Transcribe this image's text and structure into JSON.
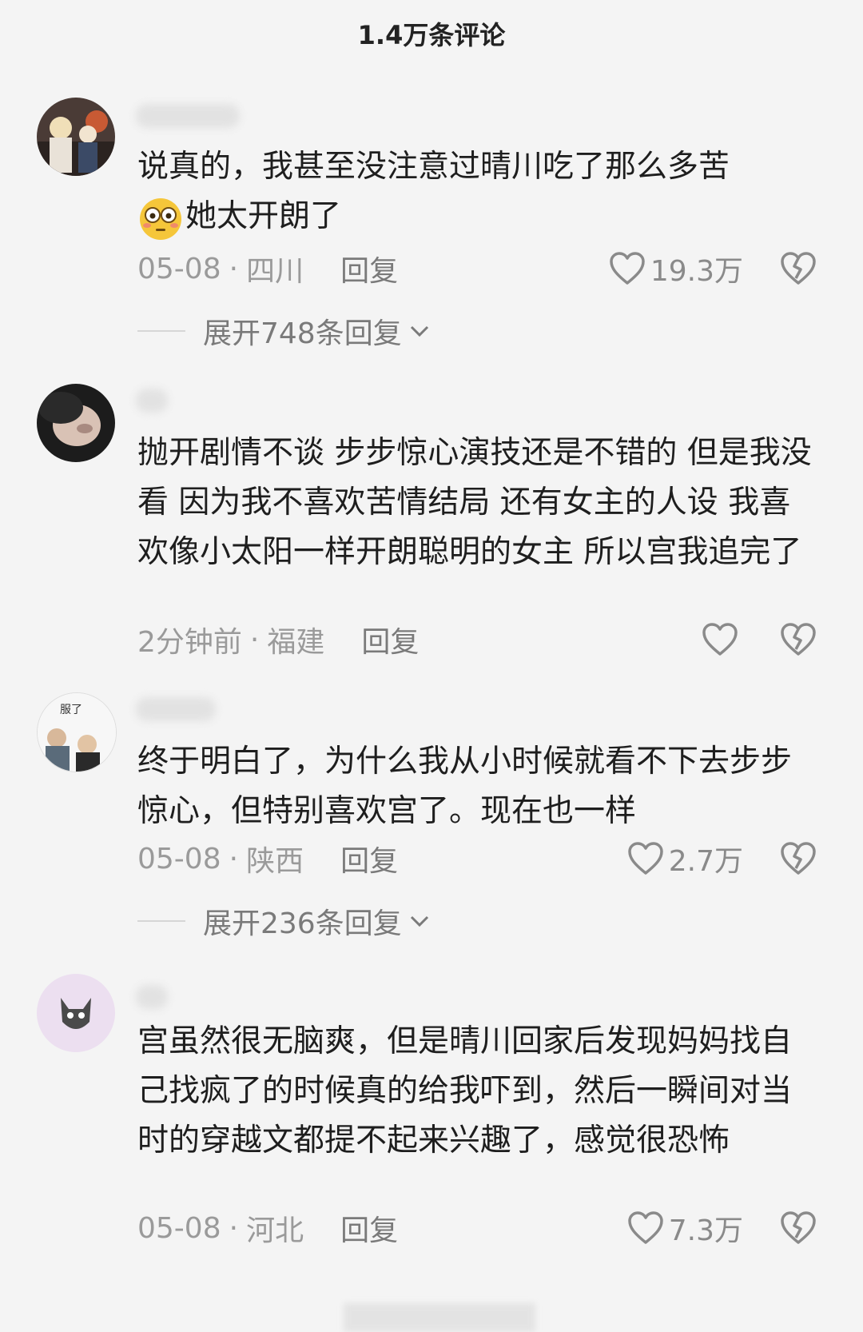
{
  "header": {
    "title": "1.4万条评论"
  },
  "comments": [
    {
      "avatar_icon": "anime-avatar",
      "text_line1": "说真的，我甚至没注意过晴川吃了那么多苦",
      "emoji": "flushed-face-emoji",
      "text_line2": "她太开朗了",
      "date": "05-08",
      "location": "四川",
      "reply": "回复",
      "likes": "19.3万",
      "expand": "展开748条回复"
    },
    {
      "avatar_icon": "photo-avatar",
      "text": "抛开剧情不谈 步步惊心演技还是不错的 但是我没看 因为我不喜欢苦情结局 还有女主的人设 我喜欢像小太阳一样开朗聪明的女主 所以宫我追完了",
      "date": "2分钟前",
      "location": "福建",
      "reply": "回复",
      "likes": ""
    },
    {
      "avatar_icon": "meme-avatar",
      "avatar_caption": "服了",
      "text": "终于明白了，为什么我从小时候就看不下去步步惊心，但特别喜欢宫了。现在也一样",
      "date": "05-08",
      "location": "陕西",
      "reply": "回复",
      "likes": "2.7万",
      "expand": "展开236条回复"
    },
    {
      "avatar_icon": "cartoon-wolf-avatar",
      "text": "宫虽然很无脑爽，但是晴川回家后发现妈妈找自己找疯了的时候真的给我吓到，然后一瞬间对当时的穿越文都提不起来兴趣了，感觉很恐怖",
      "date": "05-08",
      "location": "河北",
      "reply": "回复",
      "likes": "7.3万"
    }
  ],
  "colors": {
    "background": "#f4f4f4",
    "meta_text": "#9a9a9a",
    "body_text": "#1e1e1e"
  }
}
